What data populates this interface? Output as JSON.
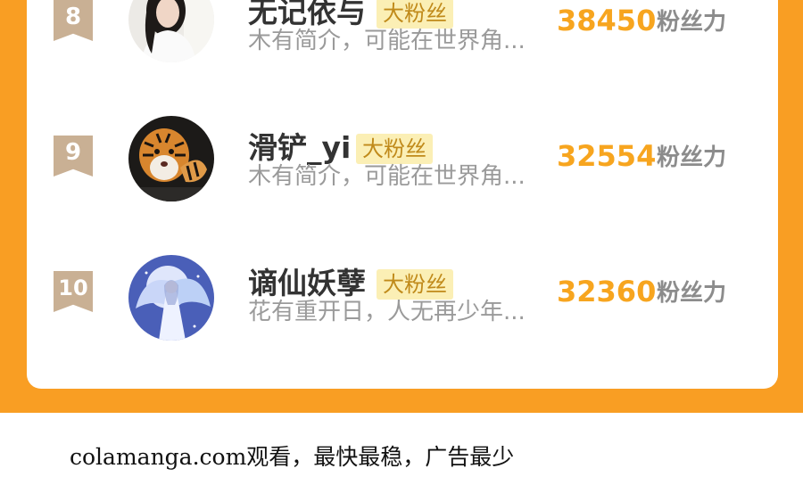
{
  "leaderboard": {
    "rows": [
      {
        "rank": "8",
        "name": "无记依与",
        "tag": "大粉丝",
        "bio": "木有简介，可能在世界角...",
        "score": "38450",
        "score_unit": "粉丝力",
        "avatar_icon": "avatar-girl-portrait"
      },
      {
        "rank": "9",
        "name": "滑铲_yi",
        "tag": "大粉丝",
        "bio": "木有简介，可能在世界角...",
        "score": "32554",
        "score_unit": "粉丝力",
        "avatar_icon": "avatar-tiger"
      },
      {
        "rank": "10",
        "name": "谪仙妖孽",
        "tag": "大粉丝",
        "bio": "花有重开日，人无再少年...",
        "score": "32360",
        "score_unit": "粉丝力",
        "avatar_icon": "avatar-angel"
      }
    ]
  },
  "footer": {
    "text": "colamanga.com观看，最快最稳，广告最少"
  },
  "colors": {
    "accent_orange": "#f99e23",
    "score_orange": "#f7a51f",
    "rank_badge": "#c9b094",
    "tag_background": "#fbefb5"
  }
}
